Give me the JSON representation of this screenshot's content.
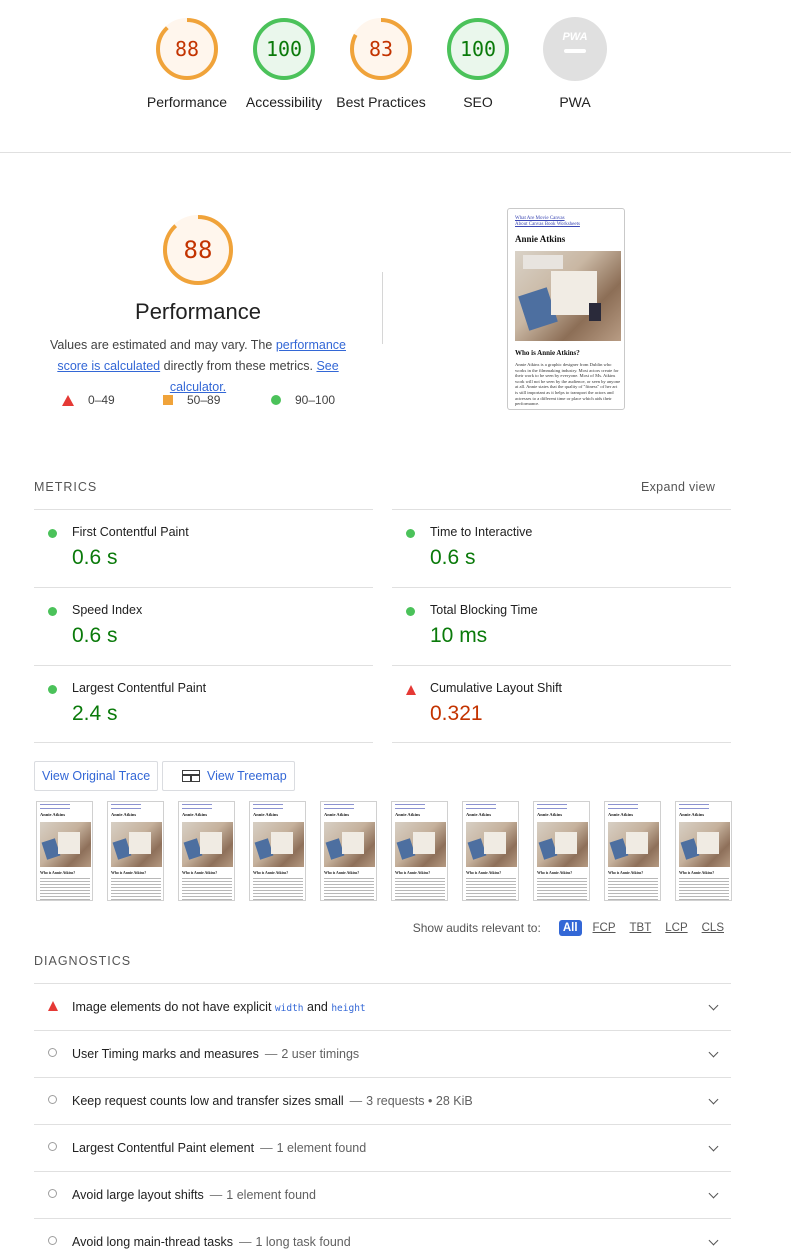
{
  "summary": {
    "gauges": [
      {
        "score": "88",
        "label": "Performance",
        "color": "#f0a33a"
      },
      {
        "score": "100",
        "label": "Accessibility",
        "color": "#4bc25a"
      },
      {
        "score": "83",
        "label": "Best Practices",
        "color": "#f0a33a"
      },
      {
        "score": "100",
        "label": "SEO",
        "color": "#4bc25a"
      },
      {
        "score": "PWA",
        "label": "PWA",
        "color": "#e0e0e0"
      }
    ]
  },
  "performance": {
    "score": "88",
    "score_fraction": 0.88,
    "title": "Performance",
    "desc_prefix": "Values are estimated and may vary. The ",
    "link_score": "performance score is calculated",
    "desc_mid": " directly from these metrics. ",
    "link_calc": "See calculator.",
    "legend": {
      "fail": "0–49",
      "average": "50–89",
      "pass": "90–100"
    }
  },
  "preview": {
    "links": [
      "What Are Movie Canvas",
      "About Canvas Book Worksheets"
    ],
    "name": "Annie Atkins",
    "heading": "Who is Annie Atkins?",
    "paragraph": "Annie Atkins is a graphic designer from Dublin who works in the filmmaking industry. Most actors create for their work to be seen by everyone. Most of Ms. Atkins work will not be seen by the audience, or seen by anyone at all. Annie states that the quality of \"fitness\" of her art is still important as it helps to transport the actors and actresses to a different time or place which aids their performance."
  },
  "metrics": {
    "title": "METRICS",
    "expand": "Expand view",
    "items": [
      {
        "label": "First Contentful Paint",
        "value": "0.6 s",
        "status": "pass"
      },
      {
        "label": "Time to Interactive",
        "value": "0.6 s",
        "status": "pass"
      },
      {
        "label": "Speed Index",
        "value": "0.6 s",
        "status": "pass"
      },
      {
        "label": "Total Blocking Time",
        "value": "10 ms",
        "status": "pass"
      },
      {
        "label": "Largest Contentful Paint",
        "value": "2.4 s",
        "status": "pass"
      },
      {
        "label": "Cumulative Layout Shift",
        "value": "0.321",
        "status": "fail"
      }
    ]
  },
  "buttons": {
    "trace": "View Original Trace",
    "treemap": "View Treemap"
  },
  "filmstrip": {
    "frame_name": "Annie Atkins",
    "frame_heading": "Who is Annie Atkins?"
  },
  "filter": {
    "label": "Show audits relevant to:",
    "chips": [
      "All",
      "FCP",
      "TBT",
      "LCP",
      "CLS"
    ]
  },
  "diagnostics": {
    "title": "DIAGNOSTICS",
    "audit0": {
      "t1": "Image elements do not have explicit ",
      "code1": "width",
      "t2": " and ",
      "code2": "height"
    },
    "items": [
      {
        "title": "User Timing marks and measures",
        "display": "2 user timings"
      },
      {
        "title": "Keep request counts low and transfer sizes small",
        "display": "3 requests • 28 KiB"
      },
      {
        "title": "Largest Contentful Paint element",
        "display": "1 element found"
      },
      {
        "title": "Avoid large layout shifts",
        "display": "1 element found"
      },
      {
        "title": "Avoid long main-thread tasks",
        "display": "1 long task found"
      }
    ],
    "separator": "—"
  },
  "colors": {
    "pass": "#4bc25a",
    "average": "#f0a33a",
    "fail": "#e53935",
    "link": "#3367d6"
  }
}
